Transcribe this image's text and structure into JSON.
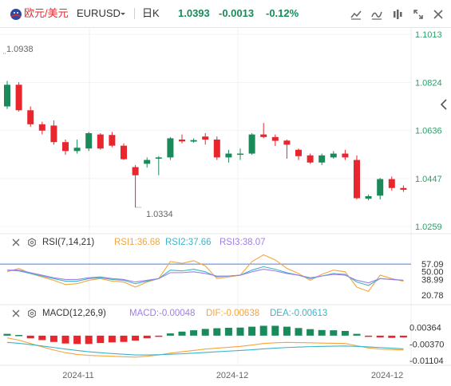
{
  "header": {
    "pair_name": "欧元/美元",
    "symbol": "EURUSD",
    "interval": "日K",
    "price": "1.0393",
    "change": "-0.0013",
    "change_pct": "-0.12%",
    "colors": {
      "up": "#1a8a5a",
      "down": "#e8262d",
      "text": "#333333"
    },
    "icons": [
      "flag-icon",
      "dropdown-caret-icon",
      "compare-icon",
      "indicator-icon",
      "settings-icon",
      "fullscreen-icon",
      "close-icon"
    ]
  },
  "chart_data": [
    {
      "type": "candlestick",
      "name": "price",
      "ylim": [
        1.0259,
        1.1013
      ],
      "y_ticks": [
        "1.1013",
        "1.0824",
        "1.0636",
        "1.0447",
        "1.0259"
      ],
      "x_ticks": [
        "2024-11",
        "2024-12",
        "2024-12"
      ],
      "annotations": {
        "high_label": "1.0938",
        "low_label": "1.0334"
      },
      "colors": {
        "up": "#1a8a5a",
        "down": "#e8262d"
      },
      "candles": [
        {
          "o": 1.073,
          "h": 1.083,
          "l": 1.072,
          "c": 1.0815
        },
        {
          "o": 1.0815,
          "h": 1.0825,
          "l": 1.071,
          "c": 1.0715
        },
        {
          "o": 1.0715,
          "h": 1.073,
          "l": 1.065,
          "c": 1.066
        },
        {
          "o": 1.066,
          "h": 1.067,
          "l": 1.062,
          "c": 1.0635
        },
        {
          "o": 1.0655,
          "h": 1.0675,
          "l": 1.058,
          "c": 1.059
        },
        {
          "o": 1.059,
          "h": 1.06,
          "l": 1.054,
          "c": 1.0555
        },
        {
          "o": 1.0555,
          "h": 1.06,
          "l": 1.0545,
          "c": 1.0568
        },
        {
          "o": 1.0565,
          "h": 1.063,
          "l": 1.0555,
          "c": 1.0625
        },
        {
          "o": 1.062,
          "h": 1.0625,
          "l": 1.056,
          "c": 1.0565
        },
        {
          "o": 1.0618,
          "h": 1.063,
          "l": 1.057,
          "c": 1.0576
        },
        {
          "o": 1.0576,
          "h": 1.0585,
          "l": 1.052,
          "c": 1.0523
        },
        {
          "o": 1.0492,
          "h": 1.05,
          "l": 1.0334,
          "c": 1.046
        },
        {
          "o": 1.0505,
          "h": 1.053,
          "l": 1.049,
          "c": 1.052
        },
        {
          "o": 1.0525,
          "h": 1.0535,
          "l": 1.046,
          "c": 1.053
        },
        {
          "o": 1.053,
          "h": 1.061,
          "l": 1.052,
          "c": 1.0605
        },
        {
          "o": 1.06,
          "h": 1.062,
          "l": 1.0585,
          "c": 1.0593
        },
        {
          "o": 1.0592,
          "h": 1.0605,
          "l": 1.0588,
          "c": 1.0598
        },
        {
          "o": 1.0612,
          "h": 1.0625,
          "l": 1.058,
          "c": 1.06
        },
        {
          "o": 1.06,
          "h": 1.0612,
          "l": 1.052,
          "c": 1.053
        },
        {
          "o": 1.053,
          "h": 1.056,
          "l": 1.051,
          "c": 1.0545
        },
        {
          "o": 1.0545,
          "h": 1.0565,
          "l": 1.052,
          "c": 1.0545
        },
        {
          "o": 1.0545,
          "h": 1.0625,
          "l": 1.054,
          "c": 1.062
        },
        {
          "o": 1.062,
          "h": 1.0665,
          "l": 1.0605,
          "c": 1.061
        },
        {
          "o": 1.061,
          "h": 1.062,
          "l": 1.0575,
          "c": 1.0595
        },
        {
          "o": 1.0596,
          "h": 1.06,
          "l": 1.0525,
          "c": 1.058
        },
        {
          "o": 1.056,
          "h": 1.0565,
          "l": 1.052,
          "c": 1.0535
        },
        {
          "o": 1.0538,
          "h": 1.0545,
          "l": 1.0505,
          "c": 1.051
        },
        {
          "o": 1.051,
          "h": 1.0545,
          "l": 1.05,
          "c": 1.0538
        },
        {
          "o": 1.053,
          "h": 1.0555,
          "l": 1.0525,
          "c": 1.0545
        },
        {
          "o": 1.0545,
          "h": 1.056,
          "l": 1.052,
          "c": 1.053
        },
        {
          "o": 1.052,
          "h": 1.0538,
          "l": 1.0365,
          "c": 1.037
        },
        {
          "o": 1.0368,
          "h": 1.0385,
          "l": 1.0362,
          "c": 1.0378
        },
        {
          "o": 1.038,
          "h": 1.045,
          "l": 1.0365,
          "c": 1.0445
        },
        {
          "o": 1.0445,
          "h": 1.0455,
          "l": 1.04,
          "c": 1.041
        },
        {
          "o": 1.041,
          "h": 1.042,
          "l": 1.0395,
          "c": 1.0403
        }
      ]
    },
    {
      "type": "line",
      "name": "rsi",
      "label": "RSI(7,14,21)",
      "ylim": [
        15,
        75
      ],
      "y_ticks": [
        "57.09",
        "50.00",
        "38.99",
        "20.78"
      ],
      "reference_line": 57.09,
      "series": [
        {
          "name": "RSI1:36.68",
          "color": "#f5a53d",
          "values": [
            48,
            52,
            46,
            42,
            38,
            33,
            34,
            38,
            40,
            37,
            36,
            30,
            36,
            40,
            60,
            58,
            61,
            55,
            40,
            42,
            44,
            60,
            68,
            62,
            52,
            46,
            38,
            45,
            50,
            48,
            30,
            25,
            44,
            40,
            37
          ]
        },
        {
          "name": "RSI2:37.66",
          "color": "#3cb4c8",
          "values": [
            50,
            49,
            46,
            43,
            40,
            37,
            37,
            40,
            41,
            39,
            38,
            34,
            37,
            40,
            50,
            49,
            51,
            48,
            42,
            43,
            44,
            50,
            54,
            51,
            47,
            44,
            40,
            43,
            46,
            45,
            36,
            32,
            40,
            39,
            38
          ]
        },
        {
          "name": "RSI3:38.07",
          "color": "#9e7fe6",
          "values": [
            50,
            50,
            47,
            44,
            41,
            39,
            39,
            41,
            42,
            40,
            39,
            36,
            38,
            40,
            47,
            47,
            48,
            46,
            43,
            43,
            44,
            48,
            51,
            49,
            46,
            44,
            41,
            43,
            45,
            44,
            38,
            35,
            40,
            39,
            38
          ]
        }
      ]
    },
    {
      "type": "bar+line",
      "name": "macd",
      "label": "MACD(12,26,9)",
      "ylim": [
        -0.0125,
        0.006
      ],
      "y_ticks": [
        "0.00364",
        "-0.00370",
        "-0.01104"
      ],
      "series": [
        {
          "name": "MACD:-0.00048",
          "color": "#9e7fe6",
          "values": [
            0.0008,
            0.0003,
            -0.0012,
            -0.002,
            -0.0028,
            -0.0035,
            -0.0037,
            -0.0037,
            -0.0033,
            -0.003,
            -0.0028,
            -0.0022,
            -0.0012,
            -0.0002,
            0.001,
            0.0018,
            0.0024,
            0.003,
            0.0033,
            0.0035,
            0.0036,
            0.004,
            0.0044,
            0.0044,
            0.004,
            0.0034,
            0.0029,
            0.0025,
            0.0024,
            0.0021,
            0.0008,
            -0.0003,
            -0.0008,
            -0.001,
            -0.0008
          ]
        },
        {
          "name": "DIF:-0.00638",
          "color": "#f5a53d",
          "values": [
            -0.001,
            -0.002,
            -0.0035,
            -0.005,
            -0.0064,
            -0.0076,
            -0.0084,
            -0.0088,
            -0.009,
            -0.0092,
            -0.0094,
            -0.0096,
            -0.0092,
            -0.0086,
            -0.0078,
            -0.0072,
            -0.0066,
            -0.006,
            -0.0056,
            -0.0052,
            -0.0048,
            -0.0042,
            -0.0035,
            -0.0032,
            -0.003,
            -0.0031,
            -0.0032,
            -0.0033,
            -0.0034,
            -0.0035,
            -0.0045,
            -0.0055,
            -0.006,
            -0.0062,
            -0.0064
          ]
        },
        {
          "name": "DEA:-0.00613",
          "color": "#3cb4c8",
          "values": [
            -0.003,
            -0.0034,
            -0.004,
            -0.0046,
            -0.0053,
            -0.006,
            -0.0066,
            -0.0072,
            -0.0076,
            -0.008,
            -0.0083,
            -0.0086,
            -0.0086,
            -0.0085,
            -0.0083,
            -0.0081,
            -0.0078,
            -0.0075,
            -0.0072,
            -0.0069,
            -0.0066,
            -0.0063,
            -0.0059,
            -0.0056,
            -0.0053,
            -0.0051,
            -0.0049,
            -0.0048,
            -0.0047,
            -0.0046,
            -0.0048,
            -0.005,
            -0.0053,
            -0.0056,
            -0.0059
          ]
        }
      ]
    }
  ]
}
